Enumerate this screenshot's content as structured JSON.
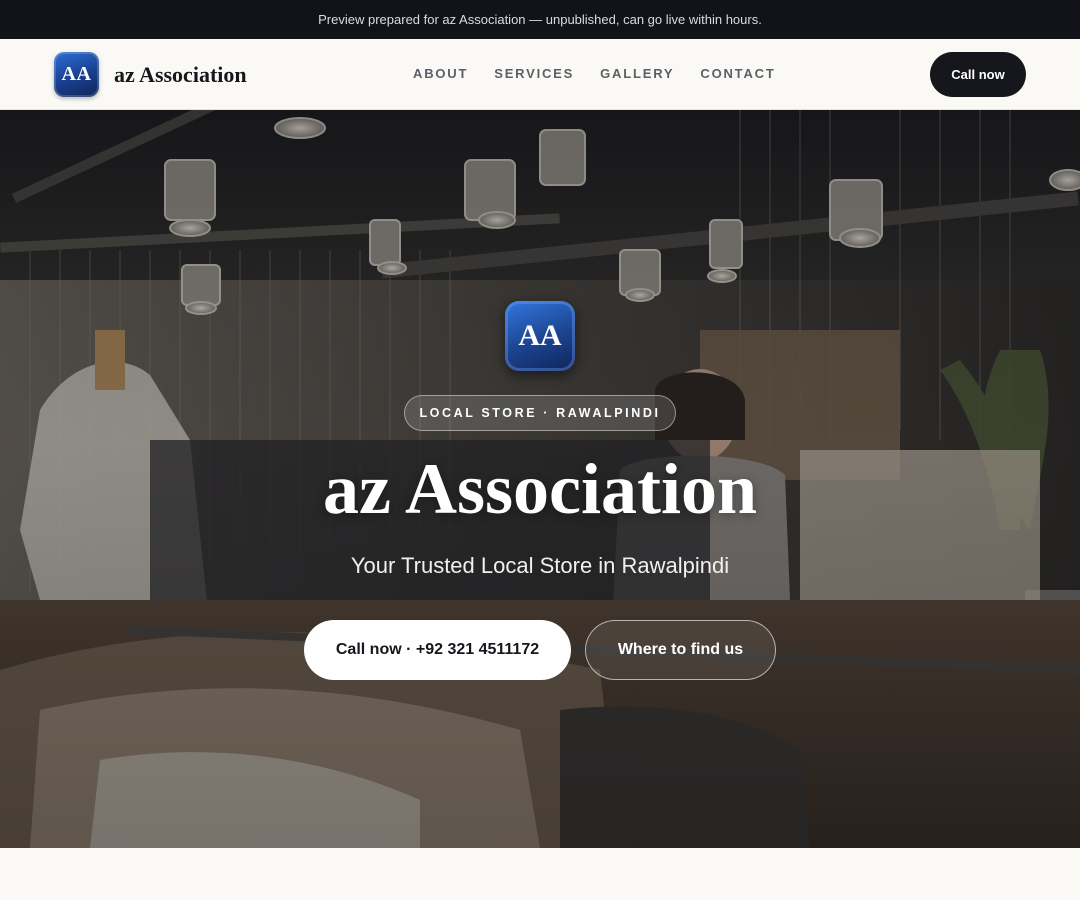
{
  "preview_bar": {
    "text": "Preview prepared for az Association — unpublished, can go live within hours."
  },
  "header": {
    "logo_initials": "AA",
    "brand_name": "az Association",
    "nav": [
      {
        "label": "ABOUT"
      },
      {
        "label": "SERVICES"
      },
      {
        "label": "GALLERY"
      },
      {
        "label": "CONTACT"
      }
    ],
    "cta_label": "Call now"
  },
  "hero": {
    "logo_initials": "AA",
    "eyebrow": "LOCAL STORE · RAWALPINDI",
    "title": "az Association",
    "tagline": "Your Trusted Local Store in Rawalpindi",
    "primary_button": "Call now · +92 321 4511172",
    "secondary_button": "Where to find us",
    "background_image": "clothing-store-interior-photo"
  },
  "colors": {
    "dark": "#111318",
    "page_bg": "#faf9f6",
    "brand_blue": "#1c448f",
    "nav_text": "#5b5f68"
  }
}
